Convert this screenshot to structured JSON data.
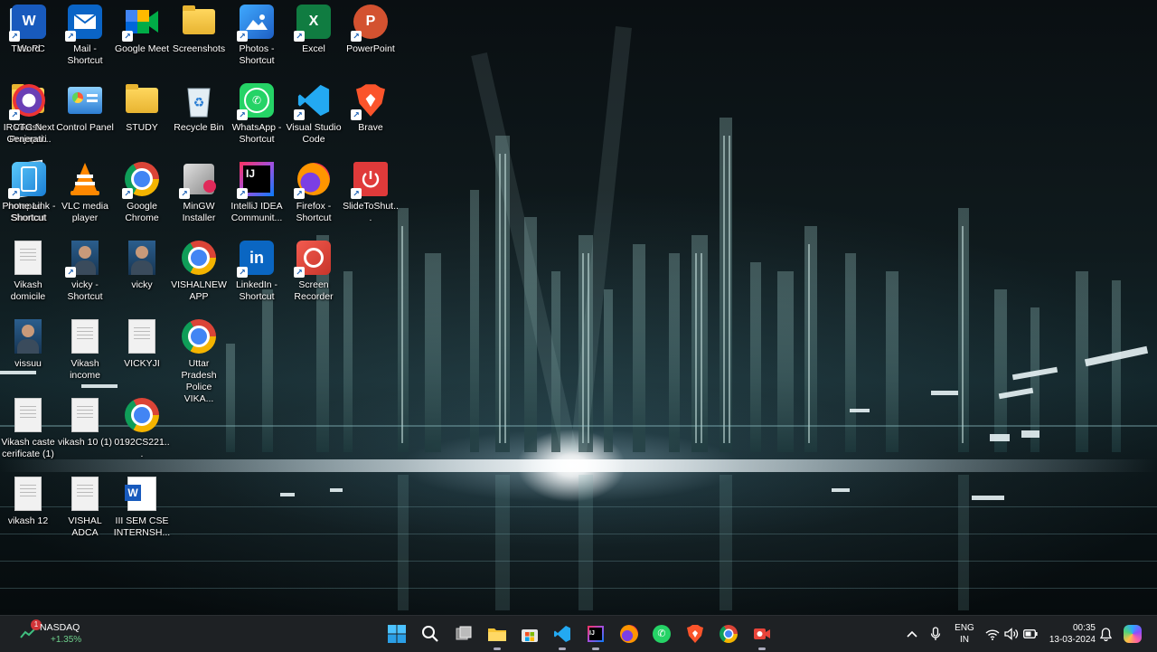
{
  "desktop": {
    "icons": [
      {
        "label": "This PC",
        "icon": "monitor-icon",
        "shortcut": false
      },
      {
        "label": "Vikash Prajapati",
        "icon": "user-folder-icon",
        "shortcut": false
      },
      {
        "label": "notepad - Shortcut",
        "icon": "notepad-icon",
        "shortcut": true
      },
      {
        "label": "Vikash domicile",
        "icon": "document-icon",
        "shortcut": false
      },
      {
        "label": "vissuu",
        "icon": "photo-icon",
        "shortcut": false
      },
      {
        "label": "Vikash caste cerificate (1)",
        "icon": "document-icon",
        "shortcut": false
      },
      {
        "label": "vikash 12",
        "icon": "document-icon",
        "shortcut": false
      },
      {
        "label": "Mail - Shortcut",
        "icon": "mail-icon",
        "shortcut": true
      },
      {
        "label": "Control Panel",
        "icon": "control-panel-icon",
        "shortcut": false
      },
      {
        "label": "VLC media player",
        "icon": "vlc-icon",
        "shortcut": false
      },
      {
        "label": "vicky - Shortcut",
        "icon": "photo-icon",
        "shortcut": true
      },
      {
        "label": "Vikash income",
        "icon": "document-icon",
        "shortcut": false
      },
      {
        "label": "vikash 10 (1)",
        "icon": "document-icon",
        "shortcut": false
      },
      {
        "label": "VISHAL ADCA",
        "icon": "document-icon",
        "shortcut": false
      },
      {
        "label": "Google Meet",
        "icon": "google-meet-icon",
        "shortcut": true
      },
      {
        "label": "STUDY",
        "icon": "folder-icon",
        "shortcut": false
      },
      {
        "label": "Google Chrome",
        "icon": "chrome-icon",
        "shortcut": true
      },
      {
        "label": "vicky",
        "icon": "photo-icon",
        "shortcut": false
      },
      {
        "label": "VICKYJI",
        "icon": "document-icon",
        "shortcut": false
      },
      {
        "label": "0192CS221...",
        "icon": "chrome-icon",
        "shortcut": false
      },
      {
        "label": "III SEM CSE INTERNSH...",
        "icon": "word-doc-icon",
        "shortcut": false
      },
      {
        "label": "Screenshots",
        "icon": "folder-icon",
        "shortcut": false
      },
      {
        "label": "Recycle Bin",
        "icon": "recycle-bin-icon",
        "shortcut": false
      },
      {
        "label": "MinGW Installer",
        "icon": "mingw-icon",
        "shortcut": true
      },
      {
        "label": "VISHALNEW APP",
        "icon": "chrome-icon",
        "shortcut": false
      },
      {
        "label": "Uttar Pradesh Police VIKA...",
        "icon": "chrome-icon",
        "shortcut": false
      },
      {
        "label": "Photos - Shortcut",
        "icon": "photos-icon",
        "shortcut": true
      },
      {
        "label": "WhatsApp - Shortcut",
        "icon": "whatsapp-icon",
        "shortcut": true
      },
      {
        "label": "IntelliJ IDEA Communit...",
        "icon": "intellij-icon",
        "shortcut": true
      },
      {
        "label": "LinkedIn - Shortcut",
        "icon": "linkedin-icon",
        "shortcut": true
      },
      {
        "label": "Excel",
        "icon": "excel-icon",
        "shortcut": true
      },
      {
        "label": "Visual Studio Code",
        "icon": "vscode-icon",
        "shortcut": true
      },
      {
        "label": "Firefox - Shortcut",
        "icon": "firefox-icon",
        "shortcut": true
      },
      {
        "label": "Screen Recorder",
        "icon": "screen-recorder-icon",
        "shortcut": true
      },
      {
        "label": "PowerPoint",
        "icon": "powerpoint-icon",
        "shortcut": true
      },
      {
        "label": "Brave",
        "icon": "brave-icon",
        "shortcut": true
      },
      {
        "label": "SlideToShut...",
        "icon": "power-icon",
        "shortcut": true
      },
      {
        "label": "Word",
        "icon": "word-icon",
        "shortcut": true
      },
      {
        "label": "IRCTC Next Generati...",
        "icon": "irctc-icon",
        "shortcut": true
      },
      {
        "label": "Phone Link - Shortcut",
        "icon": "phone-link-icon",
        "shortcut": true
      }
    ]
  },
  "taskbar": {
    "widget": {
      "title": "NASDAQ",
      "change": "+1.35%",
      "badge": "1"
    },
    "apps": [
      {
        "name": "start-button",
        "icon": "windows-icon"
      },
      {
        "name": "search-button",
        "icon": "search-icon"
      },
      {
        "name": "task-view-button",
        "icon": "task-view-icon"
      },
      {
        "name": "file-explorer-button",
        "icon": "folder-icon"
      },
      {
        "name": "microsoft-store-button",
        "icon": "store-icon"
      },
      {
        "name": "vscode-button",
        "icon": "vscode-icon"
      },
      {
        "name": "intellij-button",
        "icon": "intellij-icon"
      },
      {
        "name": "firefox-button",
        "icon": "firefox-icon"
      },
      {
        "name": "whatsapp-button",
        "icon": "whatsapp-icon"
      },
      {
        "name": "brave-button",
        "icon": "brave-icon"
      },
      {
        "name": "chrome-button",
        "icon": "chrome-icon"
      },
      {
        "name": "screen-recorder-button",
        "icon": "screen-recorder-icon"
      }
    ],
    "tray": {
      "language_line1": "ENG",
      "language_line2": "IN",
      "time": "00:35",
      "date": "13-03-2024"
    }
  }
}
